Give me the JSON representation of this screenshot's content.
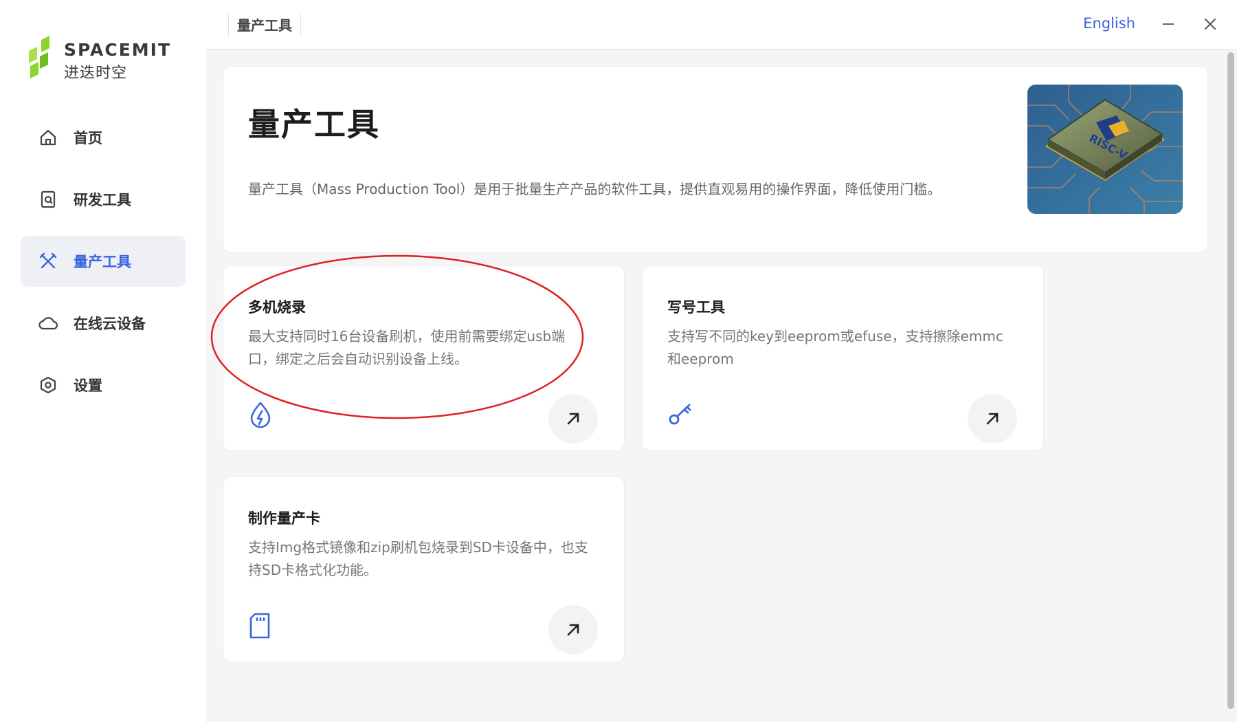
{
  "brand": {
    "name_en": "SPACEMIT",
    "name_cn": "进迭时空",
    "logo_color": "#8bd62a"
  },
  "sidebar": {
    "items": [
      {
        "label": "首页",
        "icon": "home-icon"
      },
      {
        "label": "研发工具",
        "icon": "dev-tool-icon"
      },
      {
        "label": "量产工具",
        "icon": "tools-icon",
        "active": true
      },
      {
        "label": "在线云设备",
        "icon": "cloud-icon"
      },
      {
        "label": "设置",
        "icon": "settings-icon"
      }
    ]
  },
  "titlebar": {
    "tab_title": "量产工具",
    "language": "English",
    "minimize": "—",
    "close": "✕"
  },
  "hero": {
    "title": "量产工具",
    "description": "量产工具（Mass Production Tool）是用于批量生产产品的软件工具，提供直观易用的操作界面，降低使用门槛。",
    "image": "risc-v-chip-image"
  },
  "cards": [
    {
      "title": "多机烧录",
      "description": "最大支持同时16台设备刷机，使用前需要绑定usb端口，绑定之后会自动识别设备上线。",
      "icon": "flash-drop-icon"
    },
    {
      "title": "写号工具",
      "description": "支持写不同的key到eeprom或efuse，支持擦除emmc和eeprom",
      "icon": "key-icon"
    },
    {
      "title": "制作量产卡",
      "description": "支持Img格式镜像和zip刷机包烧录到SD卡设备中，也支持SD卡格式化功能。",
      "icon": "sd-card-icon"
    }
  ],
  "colors": {
    "accent": "#3b64e0",
    "annotation": "#e02020"
  }
}
